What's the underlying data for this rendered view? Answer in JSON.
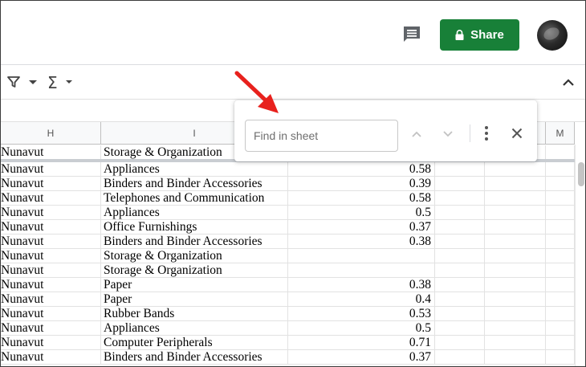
{
  "header": {
    "share_label": "Share"
  },
  "toolbar": {
    "sigma_glyph": "Σ"
  },
  "columns": [
    {
      "id": "col-h",
      "label": "H"
    },
    {
      "id": "col-i",
      "label": "I"
    },
    {
      "id": "col-m",
      "label": "M"
    }
  ],
  "frozen_row": {
    "region": "Nunavut",
    "category": "Storage & Organization"
  },
  "rows": [
    {
      "region": "Nunavut",
      "category": "Appliances",
      "value": "0.58"
    },
    {
      "region": "Nunavut",
      "category": "Binders and Binder Accessories",
      "value": "0.39"
    },
    {
      "region": "Nunavut",
      "category": "Telephones and Communication",
      "value": "0.58"
    },
    {
      "region": "Nunavut",
      "category": "Appliances",
      "value": "0.5"
    },
    {
      "region": "Nunavut",
      "category": "Office Furnishings",
      "value": "0.37"
    },
    {
      "region": "Nunavut",
      "category": "Binders and Binder Accessories",
      "value": "0.38"
    },
    {
      "region": "Nunavut",
      "category": "Storage & Organization",
      "value": ""
    },
    {
      "region": "Nunavut",
      "category": "Storage & Organization",
      "value": ""
    },
    {
      "region": "Nunavut",
      "category": "Paper",
      "value": "0.38"
    },
    {
      "region": "Nunavut",
      "category": "Paper",
      "value": "0.4"
    },
    {
      "region": "Nunavut",
      "category": "Rubber Bands",
      "value": "0.53"
    },
    {
      "region": "Nunavut",
      "category": "Appliances",
      "value": "0.5"
    },
    {
      "region": "Nunavut",
      "category": "Computer Peripherals",
      "value": "0.71"
    },
    {
      "region": "Nunavut",
      "category": "Binders and Binder Accessories",
      "value": "0.37"
    }
  ],
  "find": {
    "placeholder": "Find in sheet",
    "value": ""
  },
  "icons": {
    "comment": "comment-icon",
    "lock": "lock-icon",
    "filter": "filter-icon",
    "collapse": "chevron-up-icon",
    "prev": "chevron-up-icon",
    "next": "chevron-down-icon",
    "more": "more-vert-icon",
    "close": "close-icon"
  },
  "colors": {
    "share": "#188038",
    "annotation_arrow": "#e8211d"
  }
}
